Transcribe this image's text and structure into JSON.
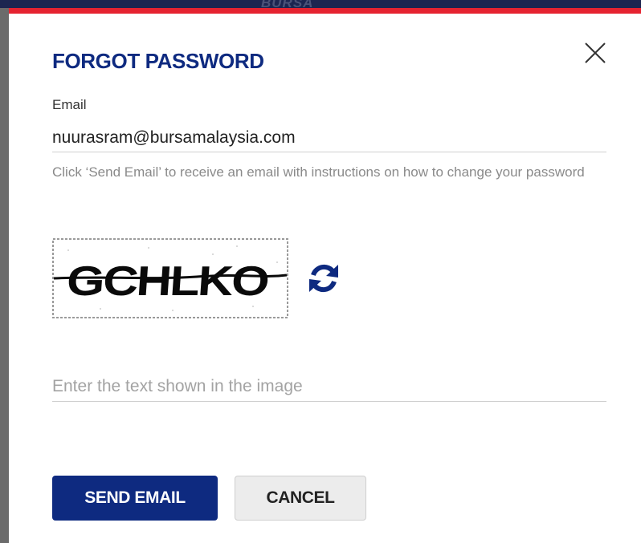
{
  "backdrop": {
    "logo_text": "BURSA"
  },
  "modal": {
    "title": "FORGOT PASSWORD",
    "close_icon": "close-icon",
    "email_label": "Email",
    "email_value": "nuurasram@bursamalaysia.com",
    "helper_text": "Click ‘Send Email’ to receive an email with instructions on how to change your password",
    "captcha": {
      "text": "GCHLKO",
      "refresh_icon": "refresh-icon"
    },
    "captcha_input_placeholder": "Enter the text shown in the image",
    "send_button_label": "SEND EMAIL",
    "cancel_button_label": "CANCEL"
  },
  "colors": {
    "brand_navy": "#0e2a80",
    "accent_red": "#e52330",
    "helper_gray": "#8a8a8a"
  }
}
